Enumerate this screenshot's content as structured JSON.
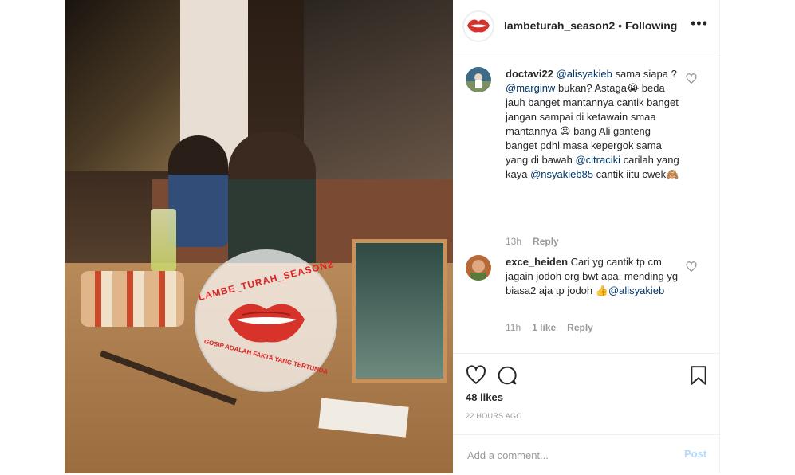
{
  "header": {
    "username": "lambeturah_season2",
    "separator": " • ",
    "follow_status": "Following",
    "more_label": "•••"
  },
  "watermark": {
    "top_text": "LAMBE_TURAH_SEASON2",
    "bottom_text": "GOSIP ADALAH FAKTA YANG TERTUNDA"
  },
  "comments": [
    {
      "username": "doctavi22",
      "segments": [
        {
          "type": "mention",
          "text": "@alisyakieb"
        },
        {
          "type": "text",
          "text": " sama siapa ? "
        },
        {
          "type": "mention",
          "text": "@marginw"
        },
        {
          "type": "text",
          "text": " bukan? Astaga😭 beda jauh banget mantannya cantik banget jangan sampai di ketawain smaa mantannya 😦 bang Ali ganteng banget pdhl masa kepergok sama yang di bawah "
        },
        {
          "type": "mention",
          "text": "@citraciki"
        },
        {
          "type": "text",
          "text": " carilah yang kaya "
        },
        {
          "type": "mention",
          "text": "@nsyakieb85"
        },
        {
          "type": "text",
          "text": " cantik iitu cwek🙈"
        }
      ],
      "time": "13h",
      "likes": "",
      "reply": "Reply"
    },
    {
      "username": "exce_heiden",
      "segments": [
        {
          "type": "text",
          "text": " Cari yg cantik tp cm jagain jodoh org bwt apa, mending yg biasa2 aja tp jodoh 👍"
        },
        {
          "type": "mention",
          "text": "@alisyakieb"
        }
      ],
      "time": "11h",
      "likes": "1 like",
      "reply": "Reply"
    }
  ],
  "post": {
    "likes": "48 likes",
    "time_ago": "22 HOURS AGO"
  },
  "add_comment": {
    "placeholder": "Add a comment...",
    "post_label": "Post"
  },
  "icons": [
    "heart-icon",
    "comment-icon",
    "bookmark-icon",
    "more-icon"
  ],
  "colors": {
    "mention": "#003569",
    "post_button_disabled": "#b3dbff",
    "meta_gray": "#999999"
  }
}
